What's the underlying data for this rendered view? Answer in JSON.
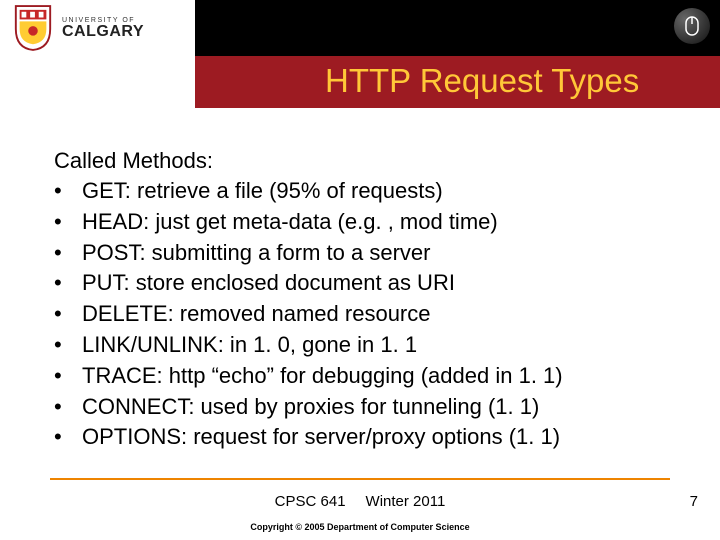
{
  "header": {
    "university_small": "UNIVERSITY OF",
    "university_large": "CALGARY",
    "title": "HTTP Request Types"
  },
  "content": {
    "lead_prefix": "Called ",
    "lead_word": "Methods",
    "lead_suffix": ":",
    "bullets": [
      "GET: retrieve a file (95% of requests)",
      "HEAD: just get meta-data (e.g. , mod time)",
      "POST: submitting a form to a server",
      "PUT: store enclosed document as URI",
      "DELETE: removed named resource",
      "LINK/UNLINK: in 1. 0, gone in 1. 1",
      "TRACE: http “echo” for debugging (added in 1. 1)",
      "CONNECT: used by proxies for tunneling (1. 1)",
      "OPTIONS: request for server/proxy options (1. 1)"
    ]
  },
  "footer": {
    "course": "CPSC 641",
    "term": "Winter 2011",
    "page": "7",
    "copyright": "Copyright © 2005 Department of Computer Science"
  }
}
